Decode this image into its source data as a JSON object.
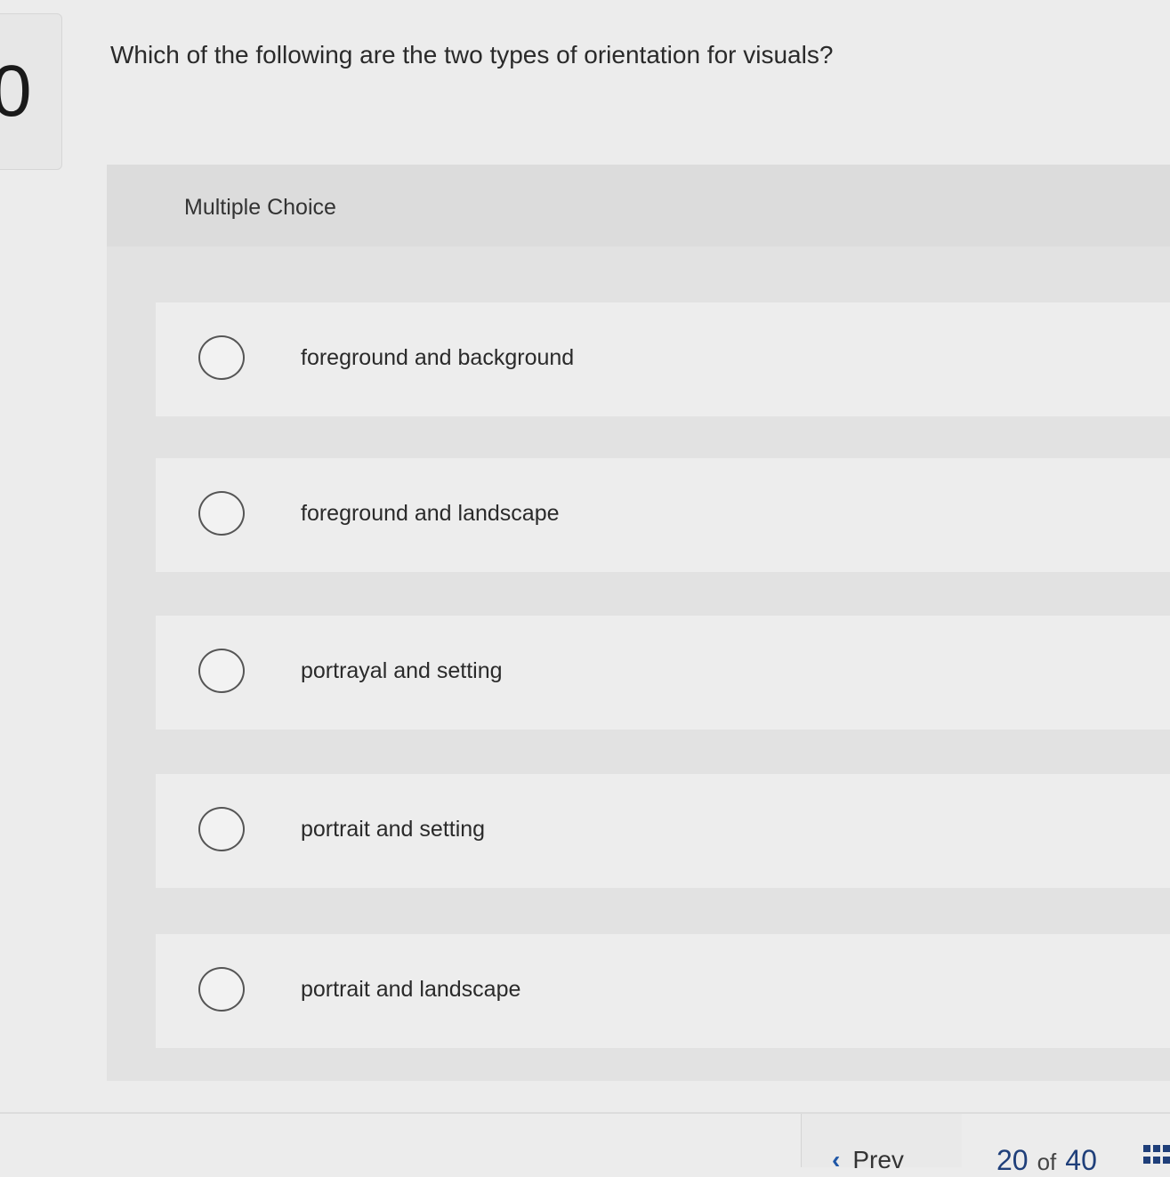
{
  "question": {
    "number": "0",
    "text": "Which of the following are the two types of orientation for visuals?"
  },
  "panel": {
    "type_label": "Multiple Choice"
  },
  "choices": [
    {
      "label": "foreground and background",
      "selected": false
    },
    {
      "label": "foreground and landscape",
      "selected": false
    },
    {
      "label": "portrayal and setting",
      "selected": false
    },
    {
      "label": "portrait and setting",
      "selected": false
    },
    {
      "label": "portrait and landscape",
      "selected": false
    }
  ],
  "footer": {
    "prev_label": "Prev",
    "current_page": "20",
    "of_label": "of",
    "total_pages": "40",
    "grid_icon": "grid-icon"
  },
  "colors": {
    "accent": "#1f3f7a",
    "chevron": "#1f56a6"
  }
}
